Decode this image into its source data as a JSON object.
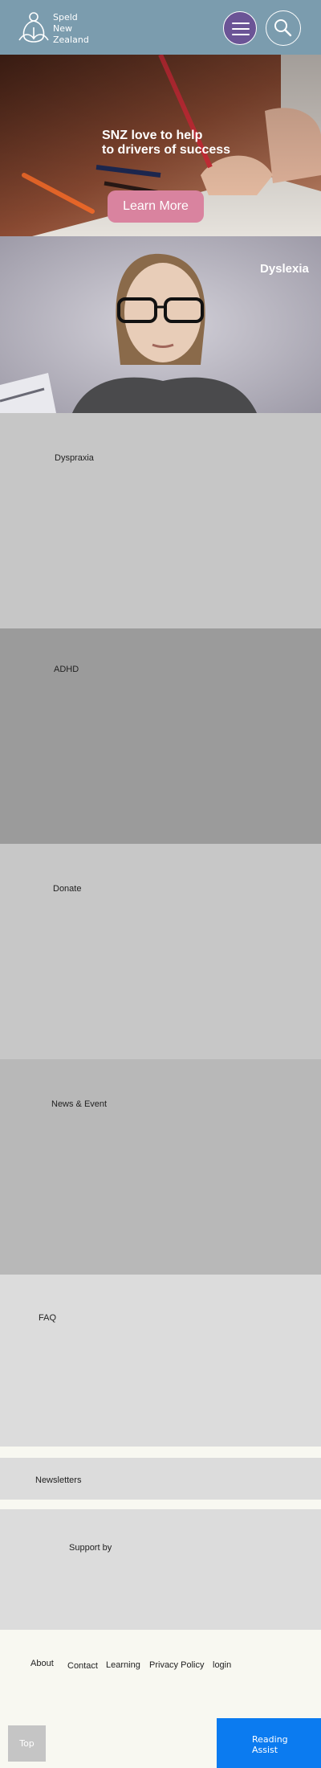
{
  "header": {
    "logo_lines": [
      "Speld",
      "New",
      "Zealand"
    ],
    "menu_icon": "hamburger-icon",
    "search_icon": "search-icon"
  },
  "hero": {
    "title_lines": [
      "SNZ love to help",
      "to drivers of success"
    ],
    "button_label": "Learn More"
  },
  "dyslexia": {
    "title": "Dyslexia"
  },
  "sections": [
    {
      "label": "Dyspraxia"
    },
    {
      "label": "ADHD"
    },
    {
      "label": "Donate"
    },
    {
      "label": "News & Event"
    },
    {
      "label": "FAQ"
    },
    {
      "label": "Newsletters"
    },
    {
      "label": "Support by"
    }
  ],
  "footer": {
    "links": [
      "About",
      "Contact",
      "Learning",
      "Privacy Policy",
      "login"
    ]
  },
  "buttons": {
    "top_label": "Top",
    "reading_assist_lines": [
      "Reading",
      "Assist"
    ]
  },
  "colors": {
    "header_bg": "#7b9cae",
    "menu_button": "#6b5496",
    "learn_more_button": "#d9839f",
    "reading_assist_button": "#0b7bf0",
    "page_bg": "#f8f8f1"
  }
}
